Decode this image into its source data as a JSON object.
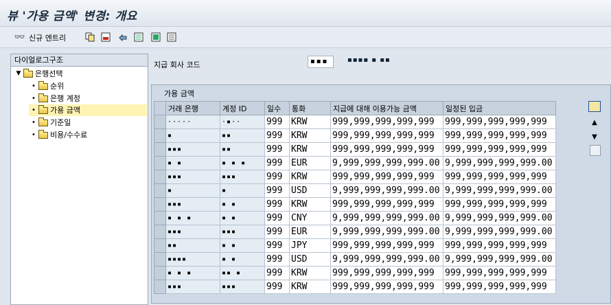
{
  "window": {
    "title": "뷰 '가용 금액' 변경: 개요"
  },
  "toolbar": {
    "new_entries_label": "신규 엔트리"
  },
  "nav": {
    "header": "다이얼로그구조",
    "root": "은행선택",
    "items": [
      "순위",
      "은행 계정",
      "가용 금액",
      "기준일",
      "비용/수수료"
    ],
    "selected_index": 2
  },
  "filter": {
    "label": "지급 회사 코드",
    "value": "▪▪▪",
    "description": "▪▪▪▪ ▪ ▪▪"
  },
  "panel": {
    "title": "가용 금액"
  },
  "table": {
    "columns": [
      "거래 은행",
      "계정 ID",
      "일수",
      "통화",
      "지급에 대해 이용가능 금액",
      "일정된 입금"
    ],
    "rows": [
      [
        "·····",
        "·▪··",
        "999",
        "KRW",
        "999,999,999,999,999",
        "999,999,999,999,999"
      ],
      [
        "▪",
        "▪▪",
        "999",
        "KRW",
        "999,999,999,999,999",
        "999,999,999,999,999"
      ],
      [
        "▪▪▪",
        "▪▪",
        "999",
        "KRW",
        "999,999,999,999,999",
        "999,999,999,999,999"
      ],
      [
        "▪ ▪",
        "▪ ▪ ▪",
        "999",
        "EUR",
        "9,999,999,999,999.00",
        "9,999,999,999,999.00"
      ],
      [
        "▪▪▪",
        "▪▪▪",
        "999",
        "KRW",
        "999,999,999,999,999",
        "999,999,999,999,999"
      ],
      [
        "▪",
        "▪",
        "999",
        "USD",
        "9,999,999,999,999.00",
        "9,999,999,999,999.00"
      ],
      [
        "▪▪▪",
        "▪ ▪",
        "999",
        "KRW",
        "999,999,999,999,999",
        "999,999,999,999,999"
      ],
      [
        "▪ ▪ ▪",
        "▪ ▪",
        "999",
        "CNY",
        "9,999,999,999,999.00",
        "9,999,999,999,999.00"
      ],
      [
        "▪▪▪",
        "▪▪▪",
        "999",
        "EUR",
        "9,999,999,999,999.00",
        "9,999,999,999,999.00"
      ],
      [
        "▪▪",
        "▪ ▪",
        "999",
        "JPY",
        "999,999,999,999,999",
        "999,999,999,999,999"
      ],
      [
        "▪▪▪▪",
        "▪ ▪",
        "999",
        "USD",
        "9,999,999,999,999.00",
        "9,999,999,999,999.00"
      ],
      [
        "▪ ▪ ▪",
        "▪▪ ▪",
        "999",
        "KRW",
        "999,999,999,999,999",
        "999,999,999,999,999"
      ],
      [
        "▪▪▪",
        "▪▪▪",
        "999",
        "KRW",
        "999,999,999,999,999",
        "999,999,999,999,999"
      ]
    ]
  },
  "icons": {
    "new_entries": "glasses-icon",
    "copy": "copy-icon",
    "delete": "delete-icon",
    "undo": "undo-icon",
    "select_all": "select-all-icon",
    "select_block": "select-block-icon",
    "deselect_all": "deselect-all-icon"
  },
  "colors": {
    "selected_node": "#fff4b3",
    "panel_bg": "#cfdae6",
    "accent": "#1d4f9a"
  }
}
